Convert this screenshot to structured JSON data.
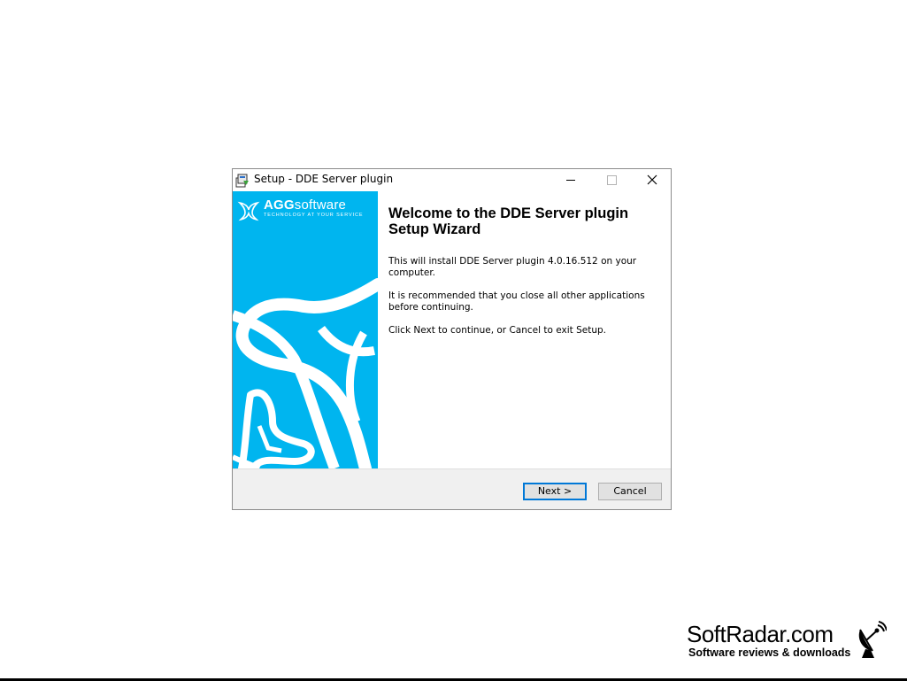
{
  "window": {
    "title": "Setup - DDE Server plugin",
    "controls": {
      "minimize": "minimize",
      "maximize": "maximize",
      "close": "close"
    }
  },
  "sidebar": {
    "logo_bold": "AGG",
    "logo_rest": "software",
    "logo_tagline": "TECHNOLOGY AT YOUR SERVICE",
    "accent_color": "#00b5ef"
  },
  "content": {
    "heading": "Welcome to the DDE Server plugin Setup Wizard",
    "paragraph_1": "This will install DDE Server plugin 4.0.16.512 on your computer.",
    "paragraph_2": "It is recommended that you close all other applications before continuing.",
    "paragraph_3": "Click Next to continue, or Cancel to exit Setup."
  },
  "footer": {
    "next_label": "Next >",
    "cancel_label": "Cancel"
  },
  "watermark": {
    "site": "SoftRadar.com",
    "tagline": "Software reviews & downloads"
  }
}
